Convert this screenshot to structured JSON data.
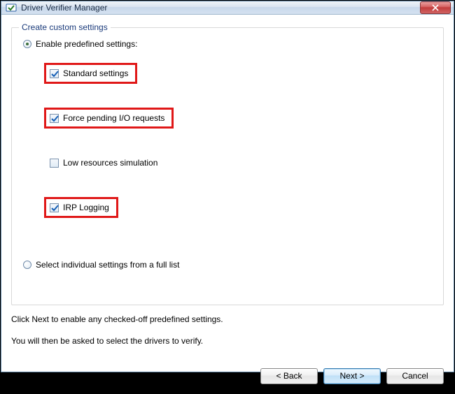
{
  "window": {
    "title": "Driver Verifier Manager"
  },
  "group": {
    "label": "Create custom settings",
    "radio_predefined": "Enable predefined settings:",
    "radio_fulllist": "Select individual settings from a full list",
    "options": {
      "standard": "Standard settings",
      "force_io": "Force pending I/O requests",
      "low_res": "Low resources simulation",
      "irp_log": "IRP Logging"
    }
  },
  "info": {
    "line1": "Click Next to enable any checked-off predefined settings.",
    "line2": "You will then be asked to select the drivers to verify."
  },
  "buttons": {
    "back": "< Back",
    "next": "Next >",
    "cancel": "Cancel"
  }
}
